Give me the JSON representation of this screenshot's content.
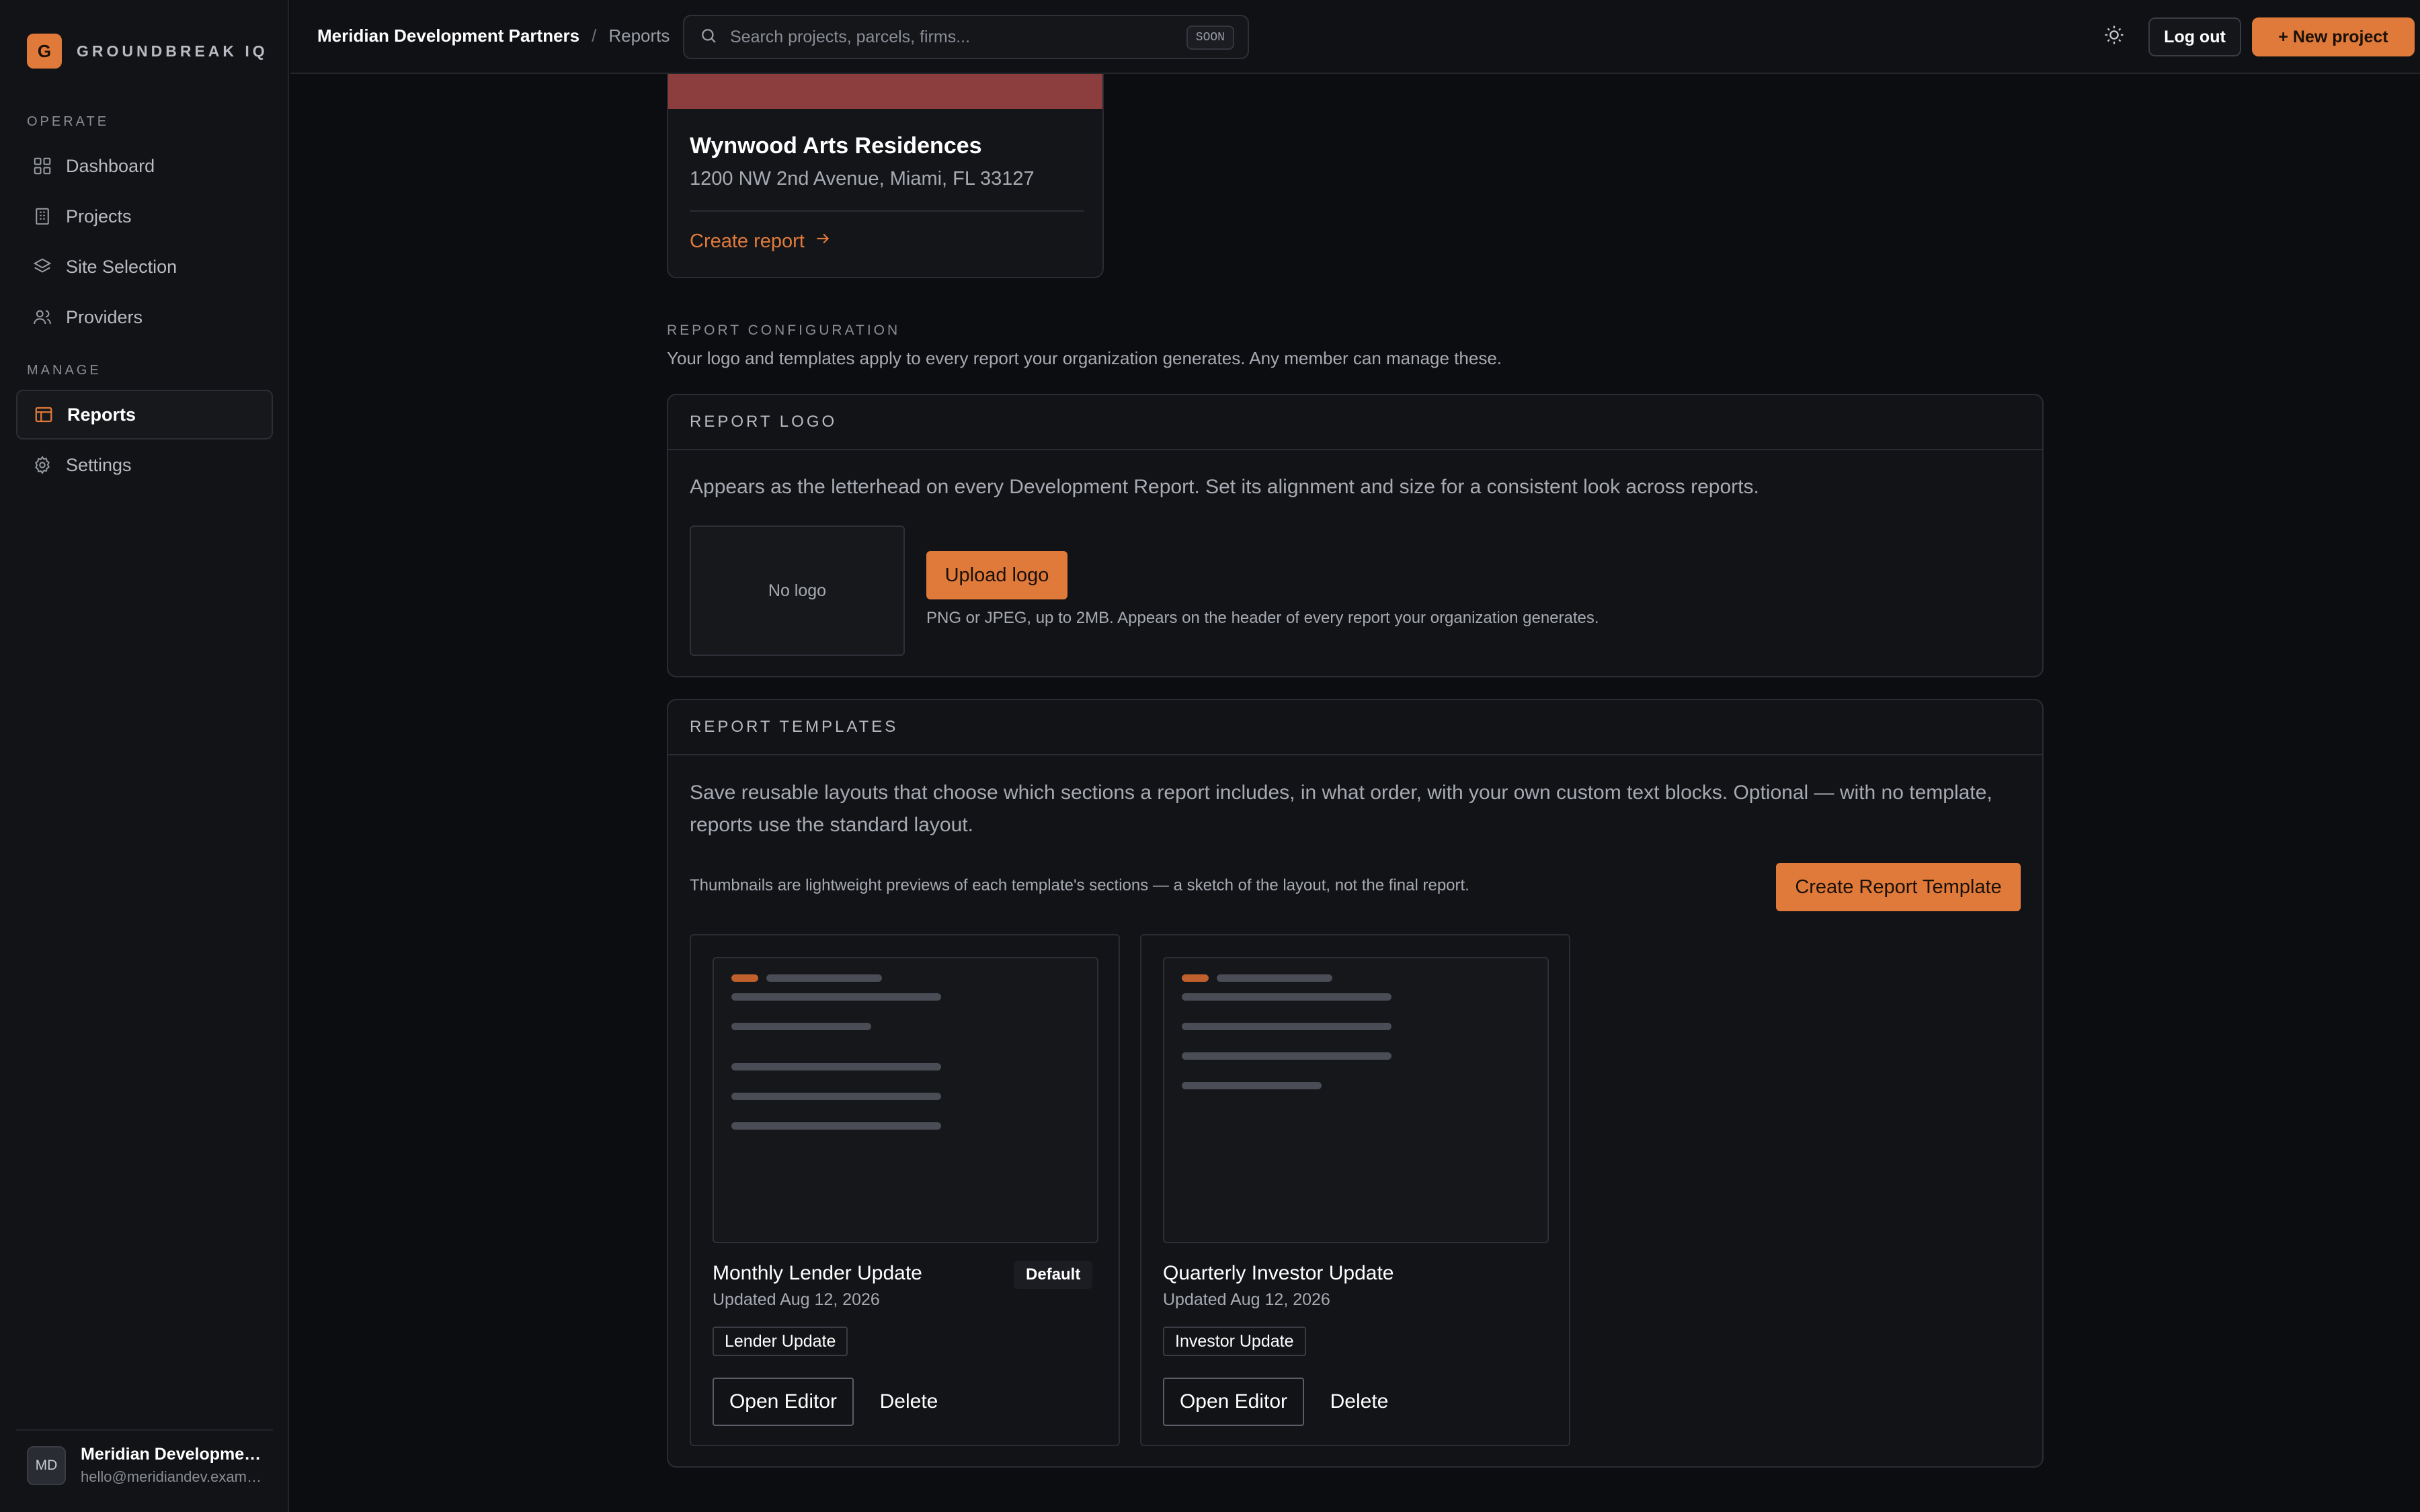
{
  "brand": {
    "mark": "G",
    "name": "GROUNDBREAK IQ"
  },
  "sidebar": {
    "sections": [
      {
        "label": "OPERATE",
        "items": [
          {
            "label": "Dashboard",
            "icon": "dashboard-grid-icon"
          },
          {
            "label": "Projects",
            "icon": "building-icon"
          },
          {
            "label": "Site Selection",
            "icon": "layers-icon"
          },
          {
            "label": "Providers",
            "icon": "users-icon"
          }
        ]
      },
      {
        "label": "MANAGE",
        "items": [
          {
            "label": "Reports",
            "icon": "table-icon",
            "active": true
          },
          {
            "label": "Settings",
            "icon": "gear-icon"
          }
        ]
      }
    ],
    "user": {
      "initials": "MD",
      "name": "Meridian Development Partners",
      "email": "hello@meridiandev.example.com"
    }
  },
  "topbar": {
    "org": "Meridian Development Partners",
    "separator": "/",
    "page": "Reports",
    "search": {
      "placeholder": "Search projects, parcels, firms...",
      "badge": "SOON"
    },
    "logout_label": "Log out",
    "new_project_label": "+ New project"
  },
  "project_card": {
    "title": "Wynwood Arts Residences",
    "address": "1200 NW 2nd Avenue, Miami, FL 33127",
    "action_label": "Create report",
    "banner_color": "#8c3e3e"
  },
  "config": {
    "label": "REPORT CONFIGURATION",
    "description": "Your logo and templates apply to every report your organization generates. Any member can manage these."
  },
  "logo_panel": {
    "heading": "REPORT LOGO",
    "description": "Appears as the letterhead on every Development Report. Set its alignment and size for a consistent look across reports.",
    "placeholder": "No logo",
    "upload_label": "Upload logo",
    "hint": "PNG or JPEG, up to 2MB. Appears on the header of every report your organization generates."
  },
  "templates_panel": {
    "heading": "REPORT TEMPLATES",
    "description": "Save reusable layouts that choose which sections a report includes, in what order, with your own custom text blocks. Optional — with no template, reports use the standard layout.",
    "hint": "Thumbnails are lightweight previews of each template's sections — a sketch of the layout, not the final report.",
    "create_label": "Create Report Template",
    "templates": [
      {
        "name": "Monthly Lender Update",
        "updated": "Updated Aug 12, 2026",
        "badge": "Default",
        "tag": "Lender Update",
        "open_label": "Open Editor",
        "delete_label": "Delete"
      },
      {
        "name": "Quarterly Investor Update",
        "updated": "Updated Aug 12, 2026",
        "tag": "Investor Update",
        "open_label": "Open Editor",
        "delete_label": "Delete"
      }
    ]
  },
  "colors": {
    "accent": "#e07a3a",
    "background": "#0c0d10",
    "panel": "#121317"
  }
}
